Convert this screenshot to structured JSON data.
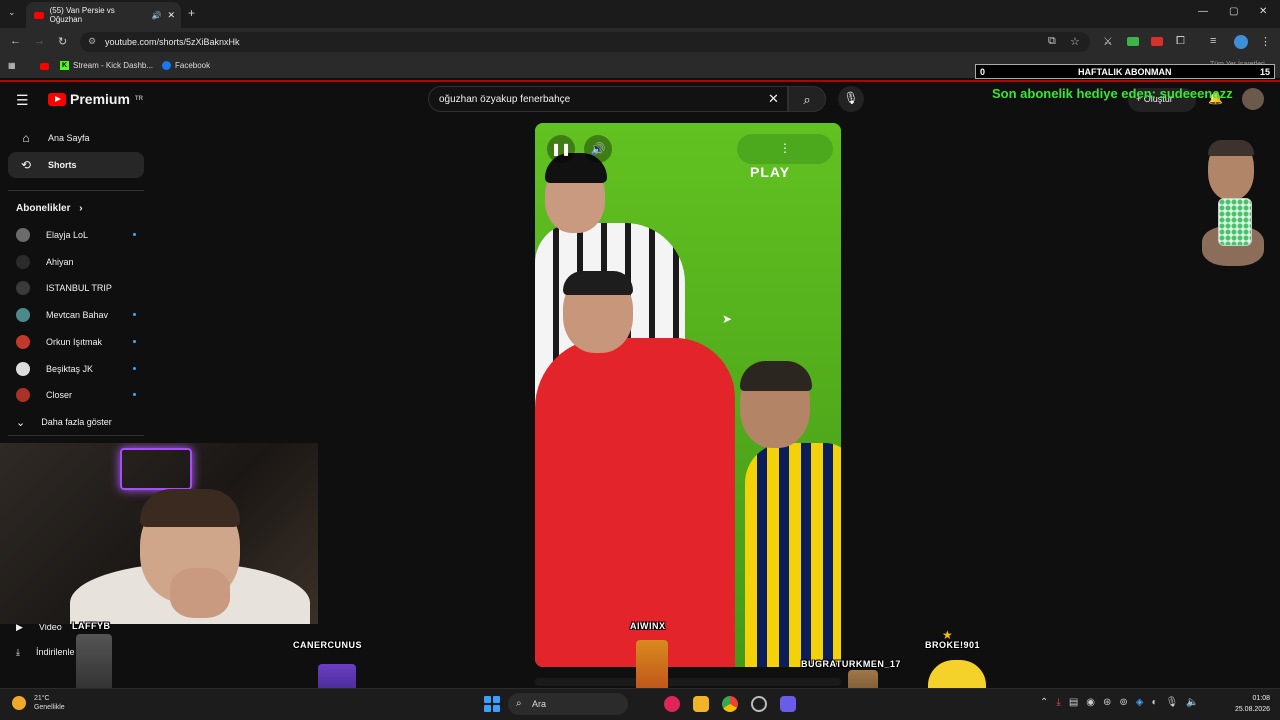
{
  "browser": {
    "tab_title": "(55) Van Persie vs Oğuzhan",
    "url": "youtube.com/shorts/5zXiBaknxHk",
    "bookmarks": [
      "Stream - Kick Dashb...",
      "Facebook"
    ],
    "bookmarks_right": "Tüm Yer İşaretleri"
  },
  "subscriber_widget": {
    "left": "0",
    "center": "HAFTALIK ABONMAN",
    "right": "15"
  },
  "youtube": {
    "logo": "Premium",
    "logo_badge": "TR",
    "search_value": "oğuzhan özyakup fenerbahçe",
    "create_label": "Oluştur"
  },
  "overlay_text": "Son abonelik hediye eden: sudeeenazz",
  "sidebar": {
    "home": "Ana Sayfa",
    "shorts": "Shorts",
    "subscriptions_header": "Abonelikler",
    "subscriptions": [
      {
        "name": "Elayja LoL",
        "dot": true,
        "color": "#6b6b6b"
      },
      {
        "name": "Ahiyan",
        "dot": false,
        "color": "#2b2b2b"
      },
      {
        "name": "ISTANBUL TRIP",
        "dot": false,
        "color": "#3a3a3a"
      },
      {
        "name": "Mevtcan Bahav",
        "dot": true,
        "color": "#4c8a8a"
      },
      {
        "name": "Orkun Işıtmak",
        "dot": true,
        "color": "#c0392b"
      },
      {
        "name": "Beşiktaş JK",
        "dot": true,
        "color": "#dddddd"
      },
      {
        "name": "Closer",
        "dot": true,
        "color": "#a93226"
      }
    ],
    "show_more": "Daha fazla göster",
    "videos_label": "Video",
    "downloads_label": "İndirilenle"
  },
  "video": {
    "play_label": "PLAY",
    "more_icon": "⋮"
  },
  "stream_names": [
    "LAFFYB",
    "CANERCUNUS",
    "AIWINX",
    "BUGRATURKMEN_17",
    "BROKE!901"
  ],
  "taskbar": {
    "weather_temp": "21°C",
    "weather_desc": "Genellikle",
    "search_label": "Ara",
    "time": "01:08",
    "date": "25.08.2026"
  }
}
